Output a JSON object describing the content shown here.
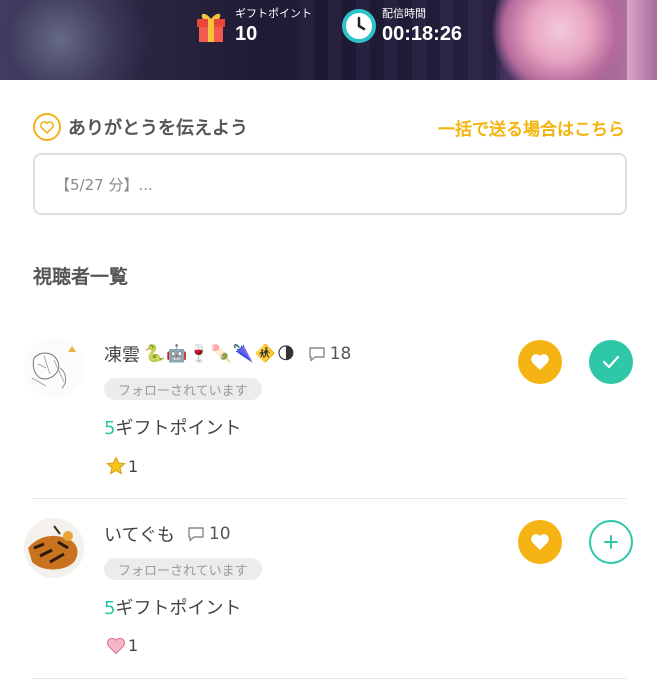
{
  "header": {
    "gift_points_label": "ギフトポイント",
    "gift_points_value": "10",
    "stream_time_label": "配信時間",
    "stream_time_value": "00:18:26"
  },
  "thanks": {
    "title": "ありがとうを伝えよう",
    "bulk_link": "一括で送る場合はこちら",
    "input_value": "【5/27 分】..."
  },
  "viewers_section": {
    "title": "視聴者一覧",
    "viewers": [
      {
        "name": "凍雲",
        "emojis": "🐍🤖🍷🍡🌂🚸🌗",
        "comment_count": "18",
        "follow_status": "フォローされています",
        "gift_amount": "5",
        "gift_unit": "ギフトポイント",
        "reaction_icon": "star-icon",
        "reaction_count": "1",
        "action_state": "thanked"
      },
      {
        "name": "いてぐも",
        "emojis": "",
        "comment_count": "10",
        "follow_status": "フォローされています",
        "gift_amount": "5",
        "gift_unit": "ギフトポイント",
        "reaction_icon": "heart-icon",
        "reaction_count": "1",
        "action_state": "not-thanked"
      }
    ]
  },
  "colors": {
    "accent_yellow": "#f4b40e",
    "accent_teal": "#2ec7a7"
  }
}
